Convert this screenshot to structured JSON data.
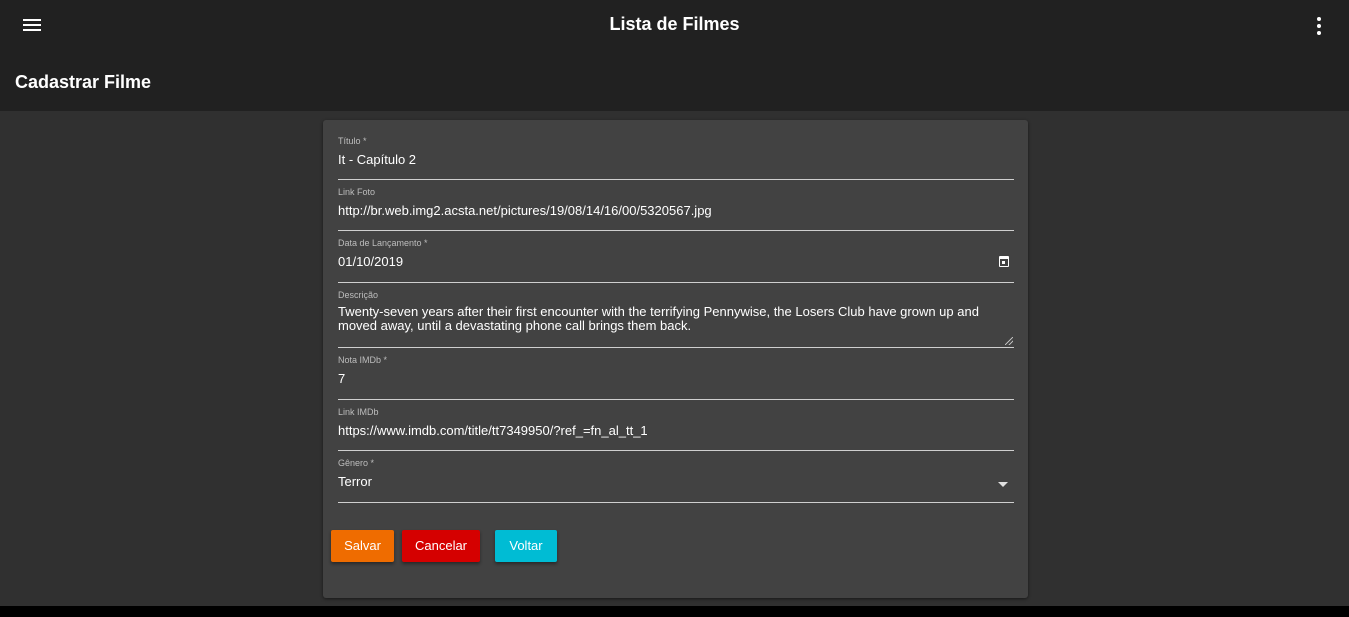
{
  "app": {
    "title": "Lista de Filmes"
  },
  "page": {
    "title": "Cadastrar Filme"
  },
  "colors": {
    "appbar": "#212121",
    "background": "#303030",
    "card": "#424242",
    "save": "#ef6c00",
    "cancel": "#d50000",
    "back": "#00bcd4"
  },
  "icons": {
    "menu": "menu-icon",
    "more": "more-vert-icon",
    "calendar": "calendar-icon",
    "dropdown": "arrow-drop-down-icon"
  },
  "form": {
    "titulo": {
      "label": "Título *",
      "value": "It - Capítulo 2"
    },
    "link_foto": {
      "label": "Link Foto",
      "value": "http://br.web.img2.acsta.net/pictures/19/08/14/16/00/5320567.jpg"
    },
    "data_lancamento": {
      "label": "Data de Lançamento *",
      "value": "01/10/2019"
    },
    "descricao": {
      "label": "Descrição",
      "value": "Twenty-seven years after their first encounter with the terrifying Pennywise, the Losers Club have grown up and moved away, until a devastating phone call brings them back."
    },
    "nota_imdb": {
      "label": "Nota IMDb *",
      "value": "7"
    },
    "link_imdb": {
      "label": "Link IMDb",
      "value": "https://www.imdb.com/title/tt7349950/?ref_=fn_al_tt_1"
    },
    "genero": {
      "label": "Gênero *",
      "value": "Terror"
    }
  },
  "buttons": {
    "save": "Salvar",
    "cancel": "Cancelar",
    "back": "Voltar"
  }
}
